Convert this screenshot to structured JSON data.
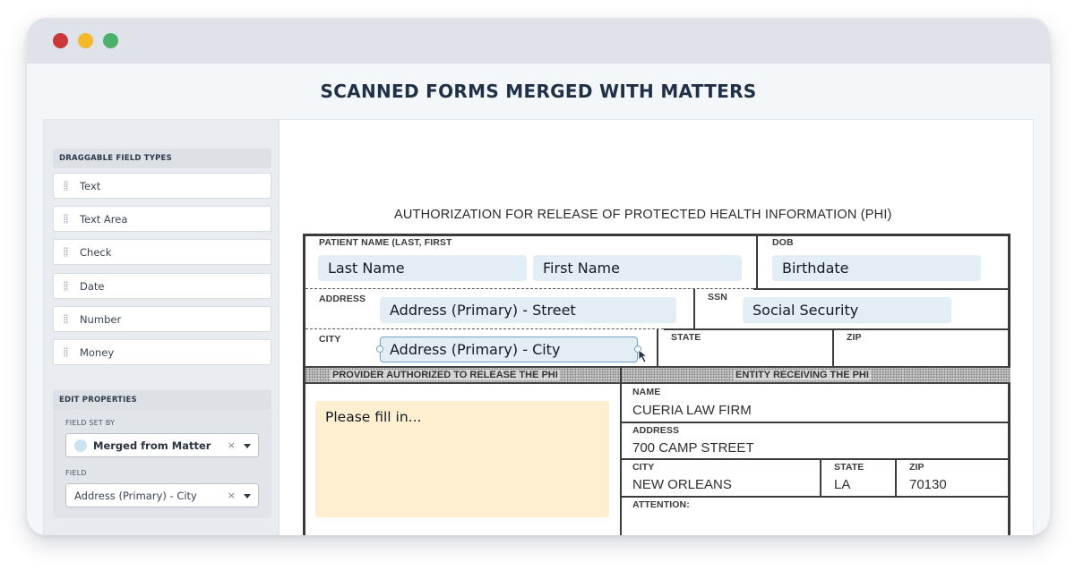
{
  "window": {
    "controls": [
      "close",
      "minimize",
      "maximize"
    ]
  },
  "heading": "SCANNED FORMS MERGED WITH MATTERS",
  "sidebar": {
    "field_types_title": "DRAGGABLE FIELD TYPES",
    "field_types": [
      {
        "label": "Text",
        "icon": "drag-handle-icon"
      },
      {
        "label": "Text Area",
        "icon": "drag-handle-icon"
      },
      {
        "label": "Check",
        "icon": "drag-handle-icon"
      },
      {
        "label": "Date",
        "icon": "drag-handle-icon"
      },
      {
        "label": "Number",
        "icon": "drag-handle-icon"
      },
      {
        "label": "Money",
        "icon": "drag-handle-icon"
      }
    ],
    "edit_properties": {
      "title": "EDIT PROPERTIES",
      "field_set_by_label": "FIELD SET BY",
      "field_set_by_value": "Merged from Matter",
      "field_set_by_color": "#cbe2ef",
      "field_label": "FIELD",
      "field_value": "Address (Primary) - City",
      "clear_glyph": "×"
    }
  },
  "document": {
    "title": "AUTHORIZATION FOR RELEASE OF PROTECTED HEALTH INFORMATION (PHI)",
    "labels": {
      "patient_name": "PATIENT NAME (LAST, FIRST",
      "dob": "DOB",
      "address": "ADDRESS",
      "ssn": "SSN",
      "city": "CITY",
      "state": "STATE",
      "zip": "ZIP"
    },
    "merge_fields": {
      "last_name": "Last Name",
      "first_name": "First Name",
      "birthdate": "Birthdate",
      "street": "Address (Primary) - Street",
      "social_security": "Social Security",
      "city": "Address (Primary) - City"
    },
    "provider_section": {
      "header": "PROVIDER AUTHORIZED TO RELEASE THE PHI",
      "placeholder": "Please fill in..."
    },
    "entity_section": {
      "header": "ENTITY RECEIVING THE PHI",
      "name_label": "NAME",
      "name_value": "CUERIA LAW FIRM",
      "address_label": "ADDRESS",
      "address_value": "700 CAMP STREET",
      "city_label": "CITY",
      "city_value": "NEW ORLEANS",
      "state_label": "STATE",
      "state_value": "LA",
      "zip_label": "ZIP",
      "zip_value": "70130",
      "attention_label": "ATTENTION:"
    }
  },
  "colors": {
    "merge_field_bg": "#e2edf4",
    "selected_border": "#6fa3c8",
    "fill_area_bg": "#fdefd0",
    "heading": "#1f3047"
  }
}
